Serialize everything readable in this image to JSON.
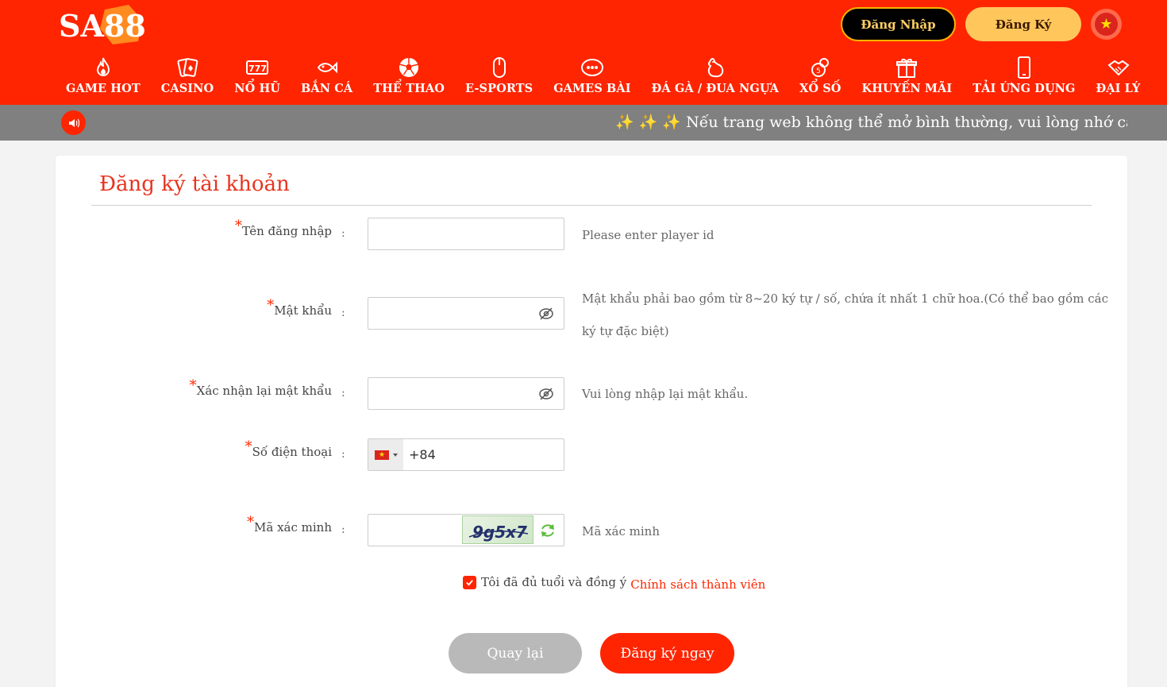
{
  "header": {
    "logo_text": "SA88",
    "login_label": "Đăng Nhập",
    "register_label": "Đăng Ký",
    "language_icon": "vietnam-flag-icon",
    "nav": [
      {
        "label": "GAME HOT",
        "icon": "flame-icon"
      },
      {
        "label": "CASINO",
        "icon": "cards-icon"
      },
      {
        "label": "NỔ HŨ",
        "icon": "slot-777-icon"
      },
      {
        "label": "BẮN CÁ",
        "icon": "fish-icon"
      },
      {
        "label": "THỂ THAO",
        "icon": "soccer-ball-icon"
      },
      {
        "label": "E-SPORTS",
        "icon": "gaming-mouse-icon"
      },
      {
        "label": "GAMES BÀI",
        "icon": "card-game-icon"
      },
      {
        "label": "ĐÁ GÀ / ĐUA NGỰA",
        "icon": "rooster-icon"
      },
      {
        "label": "XỔ SỐ",
        "icon": "lottery-icon"
      },
      {
        "label": "KHUYẾN MÃI",
        "icon": "gift-icon"
      },
      {
        "label": "TẢI ỨNG DỤNG",
        "icon": "mobile-phone-icon"
      },
      {
        "label": "ĐẠI LÝ",
        "icon": "handshake-icon"
      }
    ]
  },
  "marquee": {
    "icon": "speaker-icon",
    "text": "✨ ✨ ✨  Nếu trang web không thể mở bình thường, vui lòng nhớ các địa c"
  },
  "form": {
    "title": "Đăng ký tài khoản",
    "required_mark": "*",
    "colon": ":",
    "fields": {
      "username": {
        "label": "Tên đăng nhập",
        "value": "",
        "hint": "Please enter player id"
      },
      "password": {
        "label": "Mật khẩu",
        "value": "",
        "hint_line1": "Mật khẩu phải bao gồm từ 8~20 ký tự / số, chứa ít nhất 1 chữ hoa.(Có thể bao gồm các",
        "hint_line2": "ký tự đặc biệt)"
      },
      "confirm_password": {
        "label": "Xác nhận lại mật khẩu",
        "value": "",
        "hint": "Vui lòng nhập lại mật khẩu."
      },
      "phone": {
        "label": "Số điện thoại",
        "country_code": "+84",
        "value": ""
      },
      "captcha": {
        "label": "Mã xác minh",
        "value": "",
        "captcha_text": "9g5x7",
        "hint": "Mã xác minh"
      }
    },
    "agree_text": "Tôi đã đủ tuổi và đồng ý",
    "policy_link": "Chính sách thành viên",
    "agree_checked": true,
    "back_label": "Quay lại",
    "submit_label": "Đăng ký ngay"
  },
  "colors": {
    "brand_red": "#ff2500",
    "login_gold": "#ffcf63",
    "register_gold": "#ffc65c",
    "marquee_gray": "#808080"
  }
}
